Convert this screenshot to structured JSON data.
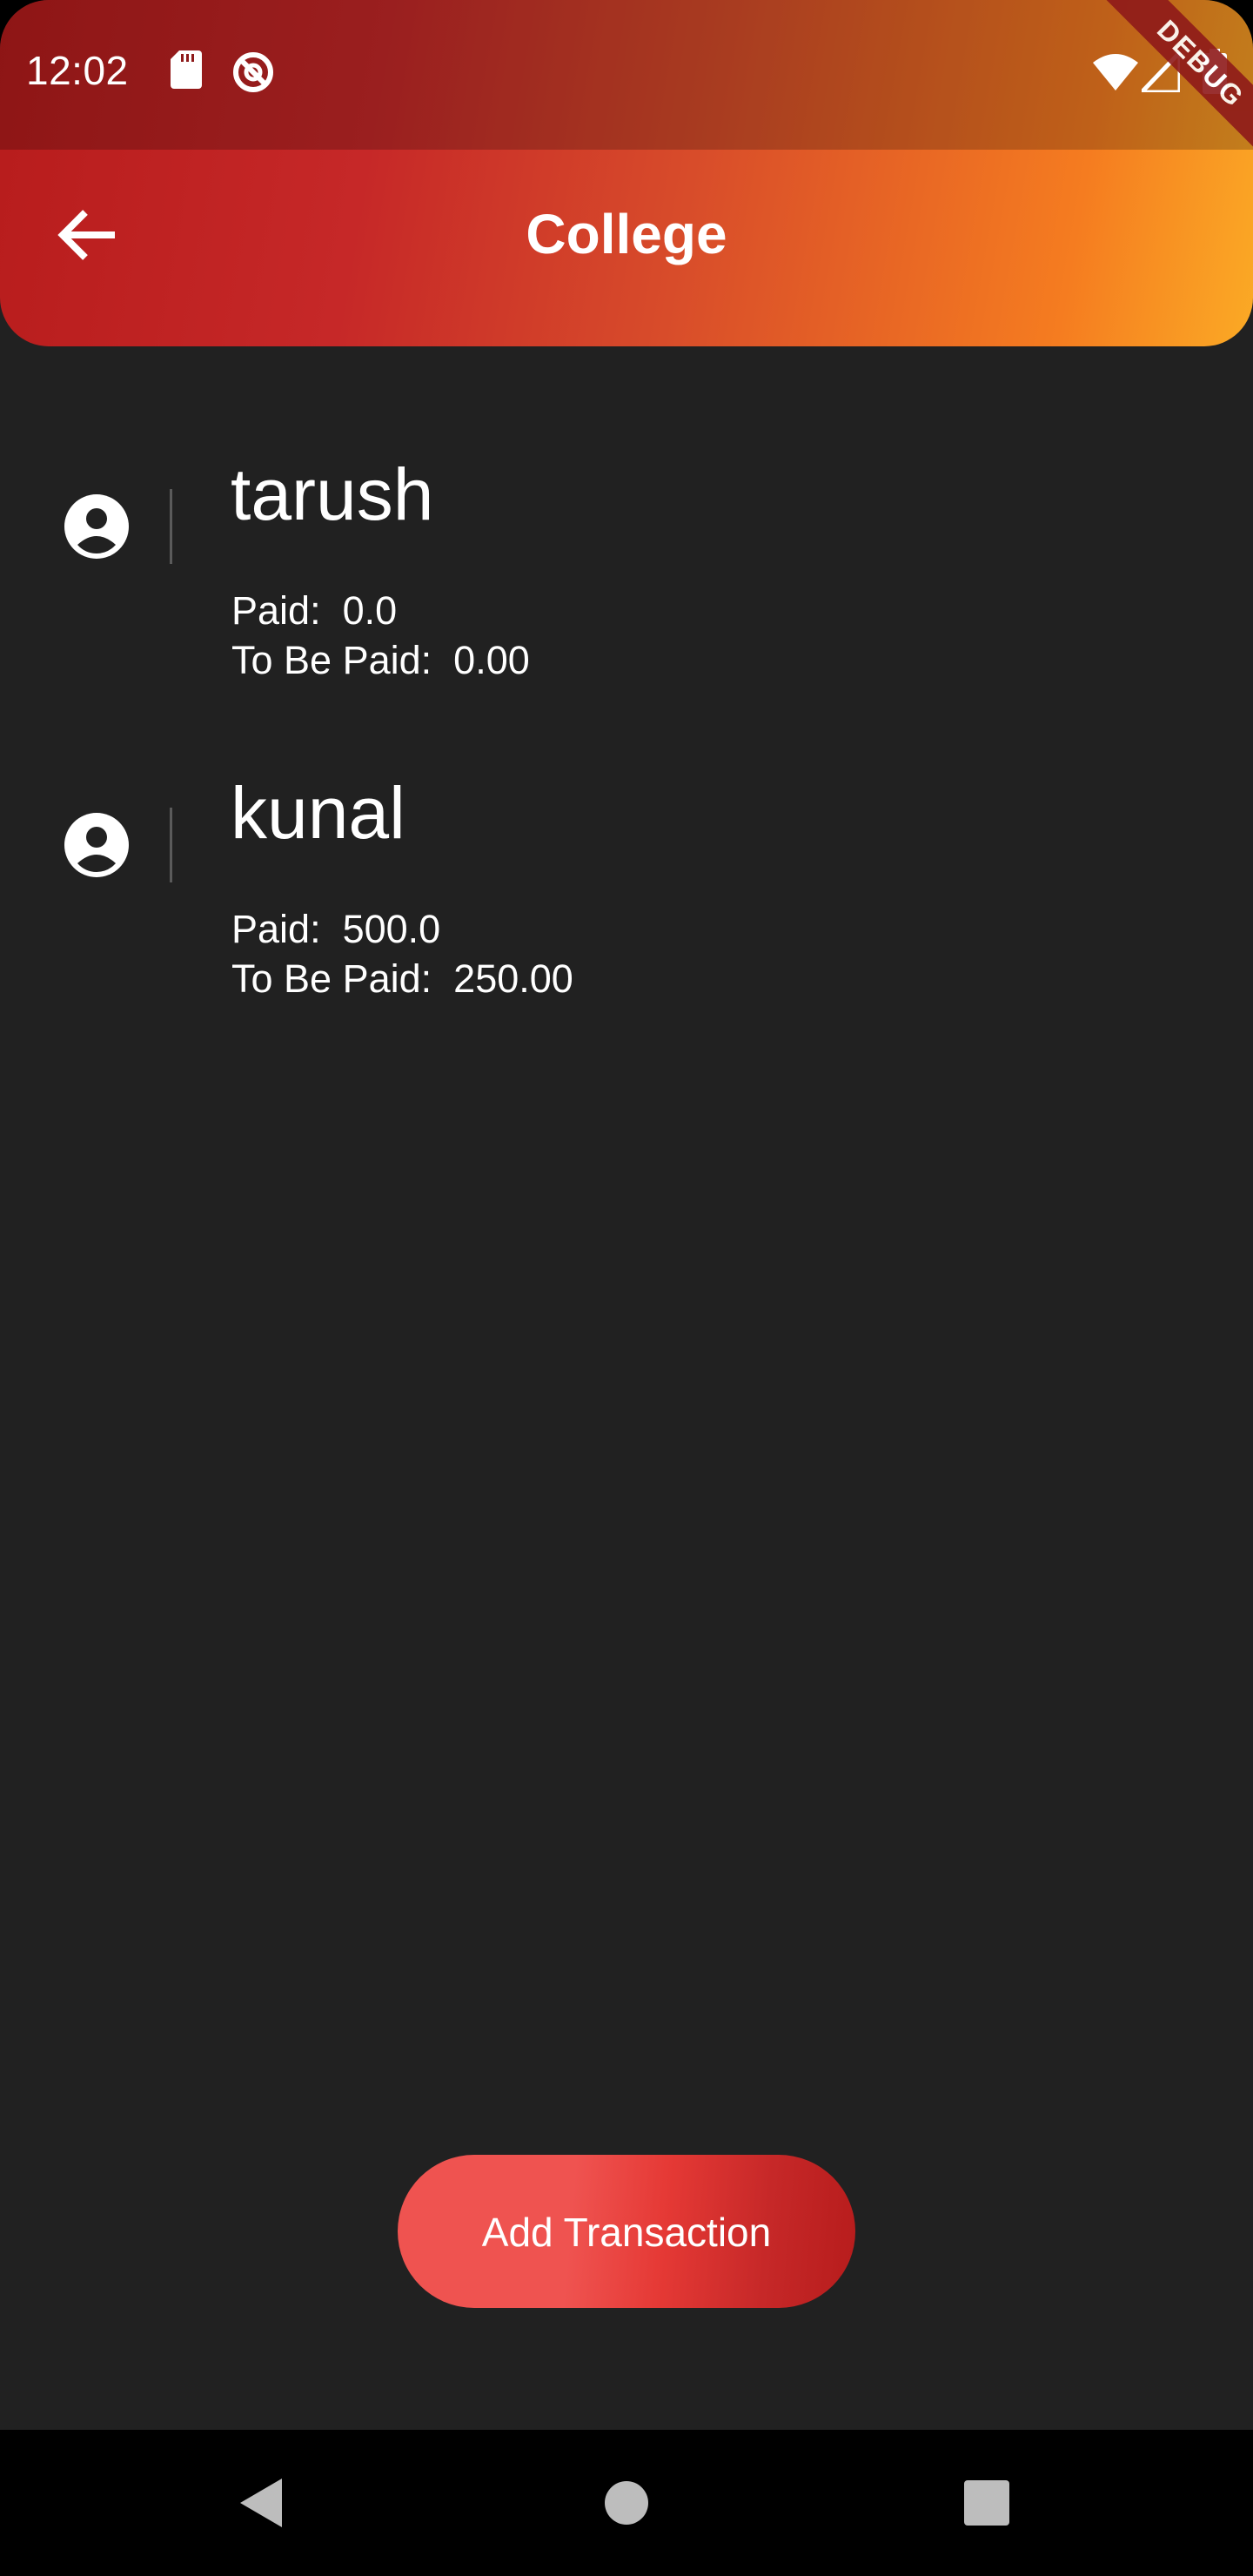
{
  "status_bar": {
    "time": "12:02",
    "icons": [
      "sd-card-icon",
      "do-not-disturb-icon",
      "wifi-icon",
      "signal-icon",
      "battery-icon"
    ]
  },
  "debug_banner": "DEBUG",
  "app_bar": {
    "title": "College",
    "back_icon": "arrow-back-icon",
    "gradient": [
      "#b71c1c",
      "#fbaa25"
    ]
  },
  "members": [
    {
      "name": "tarush",
      "paid_label": "Paid:",
      "paid": "0.0",
      "to_be_paid_label": "To Be Paid:",
      "to_be_paid": "0.00",
      "icon": "account-circle-icon"
    },
    {
      "name": "kunal",
      "paid_label": "Paid:",
      "paid": "500.0",
      "to_be_paid_label": "To Be Paid:",
      "to_be_paid": "250.00",
      "icon": "account-circle-icon"
    }
  ],
  "add_button": {
    "label": "Add Transaction",
    "color": "#ef5350"
  },
  "nav_bar": {
    "icons": [
      "back-triangle-icon",
      "home-circle-icon",
      "recents-square-icon"
    ]
  },
  "colors": {
    "background": "#212121",
    "text": "#ffffff"
  }
}
